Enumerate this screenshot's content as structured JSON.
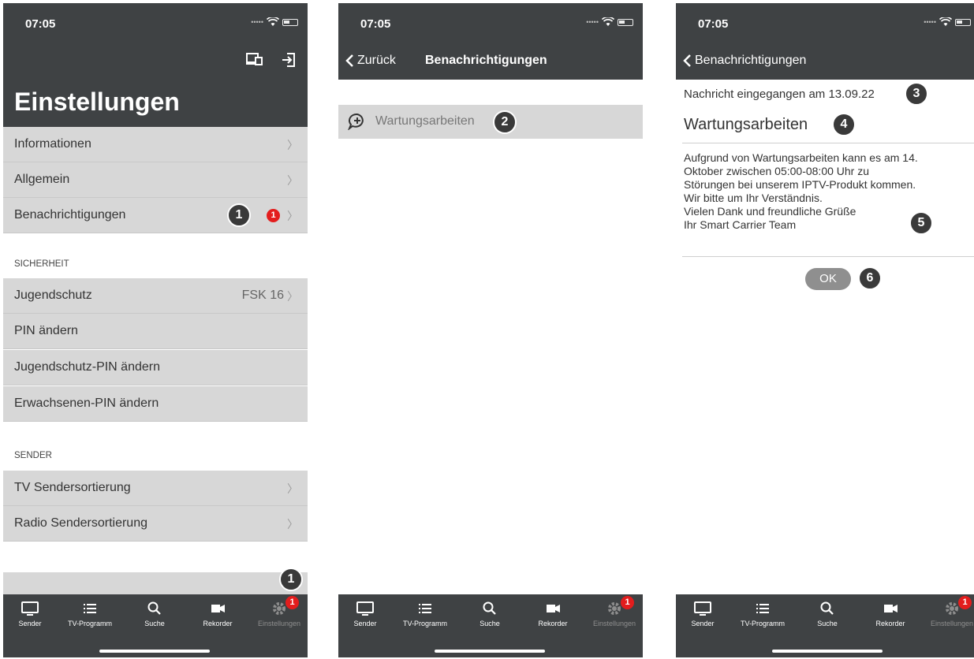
{
  "status_time": "07:05",
  "screen1": {
    "title": "Einstellungen",
    "rows_top": [
      {
        "label": "Informationen"
      },
      {
        "label": "Allgemein"
      },
      {
        "label": "Benachrichtigungen",
        "badge": "1"
      }
    ],
    "section_security": "SICHERHEIT",
    "rows_security": [
      {
        "label": "Jugendschutz",
        "value": "FSK 16"
      },
      {
        "label": "PIN ändern"
      },
      {
        "label": "Jugendschutz-PIN ändern"
      },
      {
        "label": "Erwachsenen-PIN ändern"
      }
    ],
    "section_sender": "SENDER",
    "rows_sender": [
      {
        "label": "TV Sendersortierung"
      },
      {
        "label": "Radio Sendersortierung"
      }
    ]
  },
  "screen2": {
    "back_label": "Zurück",
    "title": "Benachrichtigungen",
    "item_label": "Wartungsarbeiten"
  },
  "screen3": {
    "back_label": "Benachrichtigungen",
    "meta": "Nachricht eingegangen am 13.09.22",
    "title": "Wartungsarbeiten",
    "body_lines": [
      "Aufgrund von Wartungsarbeiten kann es am 14.",
      "Oktober zwischen 05:00-08:00 Uhr zu",
      "Störungen bei unserem IPTV-Produkt kommen.",
      "Wir bitte um Ihr Verständnis.",
      "Vielen Dank und freundliche Grüße",
      "Ihr Smart Carrier Team"
    ],
    "ok_label": "OK"
  },
  "tabs": [
    {
      "label": "Sender",
      "icon": "tv-icon"
    },
    {
      "label": "TV-Programm",
      "icon": "list-icon"
    },
    {
      "label": "Suche",
      "icon": "search-icon"
    },
    {
      "label": "Rekorder",
      "icon": "camera-icon"
    },
    {
      "label": "Einstellungen",
      "icon": "gear-icon",
      "badge": "1"
    }
  ],
  "callouts": [
    "1",
    "2",
    "3",
    "4",
    "5",
    "6"
  ],
  "colors": {
    "header": "#3f4244",
    "row": "#d7d7d7",
    "badge": "#e31d1d",
    "callout": "#3a3a3a"
  }
}
